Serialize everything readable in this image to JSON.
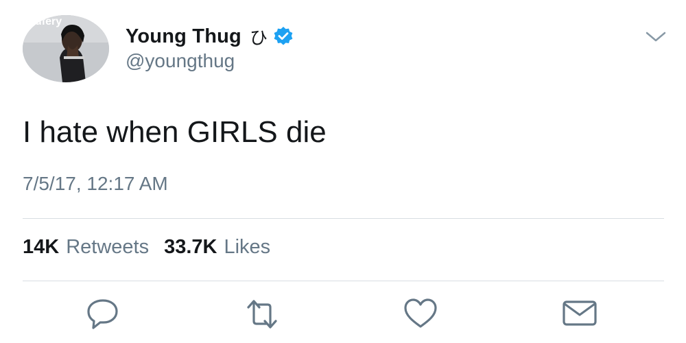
{
  "tweet": {
    "author": {
      "display_name": "Young Thug",
      "name_glyph": "ひ",
      "handle": "@youngthug",
      "avatar_overlay_text": "ufery",
      "verified": true
    },
    "text": "I hate when GIRLS die",
    "timestamp": "7/5/17, 12:17 AM",
    "stats": {
      "retweets_count": "14K",
      "retweets_label": "Retweets",
      "likes_count": "33.7K",
      "likes_label": "Likes"
    },
    "actions": [
      "reply-icon",
      "retweet-icon",
      "like-icon",
      "message-icon"
    ]
  },
  "colors": {
    "text_primary": "#14171a",
    "text_secondary": "#657786",
    "verified_blue": "#1da1f2",
    "divider": "#d8dde2"
  }
}
